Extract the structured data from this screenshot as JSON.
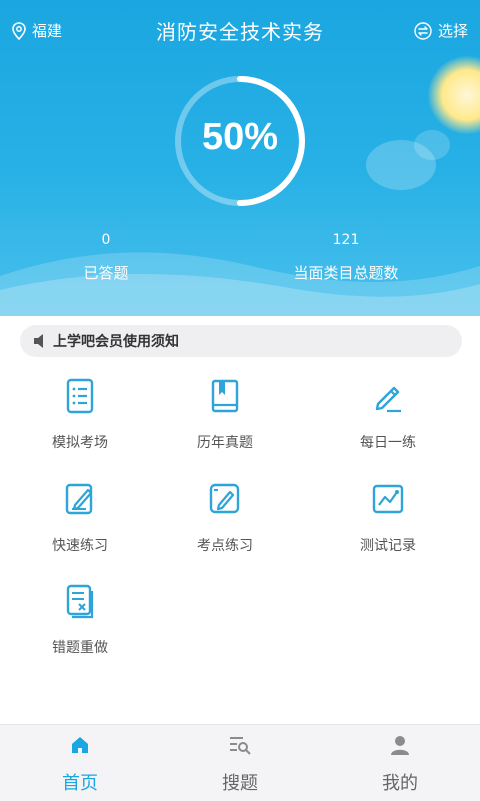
{
  "header": {
    "location": "福建",
    "title": "消防安全技术实务",
    "choose_label": "选择",
    "progress_text": "50%",
    "progress_fraction": 0.5,
    "answered_count": "0",
    "answered_label": "已答题",
    "total_count": "121",
    "total_label": "当面类目总题数"
  },
  "notice": {
    "text": "上学吧会员使用须知"
  },
  "menu": {
    "items": [
      {
        "label": "模拟考场",
        "icon": "list-doc-icon"
      },
      {
        "label": "历年真题",
        "icon": "book-icon"
      },
      {
        "label": "每日一练",
        "icon": "pencil-icon"
      },
      {
        "label": "快速练习",
        "icon": "edit-note-icon"
      },
      {
        "label": "考点练习",
        "icon": "pen-card-icon"
      },
      {
        "label": "测试记录",
        "icon": "chart-record-icon"
      },
      {
        "label": "错题重做",
        "icon": "wrong-doc-icon"
      }
    ]
  },
  "tabs": [
    {
      "label": "首页",
      "icon": "home-icon",
      "active": true
    },
    {
      "label": "搜题",
      "icon": "search-list-icon",
      "active": false
    },
    {
      "label": "我的",
      "icon": "user-icon",
      "active": false
    }
  ],
  "colors": {
    "accent": "#1aa6e0",
    "icon_blue": "#2ea4d9",
    "tab_gray": "#8a8a8f"
  }
}
